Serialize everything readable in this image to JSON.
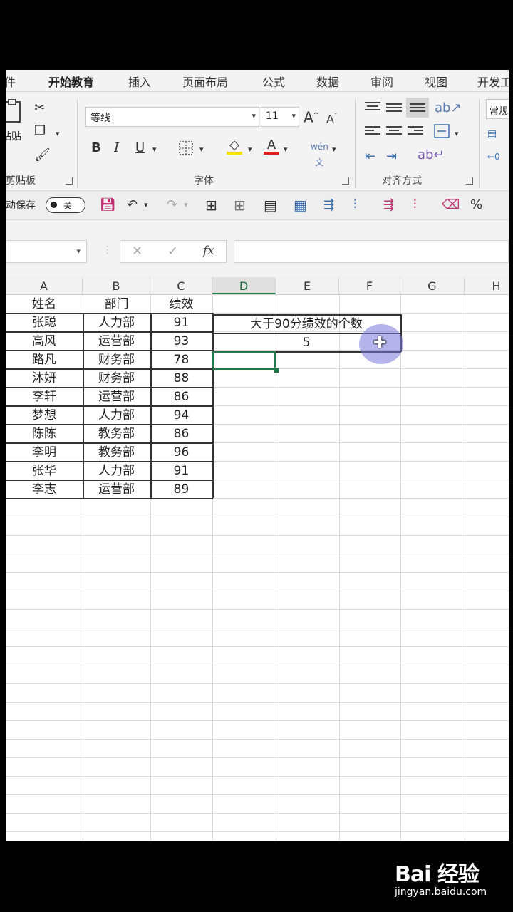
{
  "ribbon": {
    "tabs": [
      "文件",
      "开始教育",
      "插入",
      "页面布局",
      "公式",
      "数据",
      "审阅",
      "视图",
      "开发工具"
    ],
    "active_tab": "开始教育",
    "groups": {
      "clipboard": "剪贴板",
      "font": "字体",
      "alignment": "对齐方式"
    },
    "clipboard_paste_label": "粘贴",
    "font_name": "等线",
    "font_size": "11",
    "number_format": "常规"
  },
  "qat": {
    "autosave_label": "自动保存",
    "autosave_state": "关"
  },
  "formula_bar": {
    "name_box": "",
    "formula": ""
  },
  "sheet": {
    "columns": [
      "A",
      "B",
      "C",
      "D",
      "E",
      "F",
      "G",
      "H"
    ],
    "selected_column": "D",
    "table_header": [
      "姓名",
      "部门",
      "绩效"
    ],
    "rows": [
      [
        "张聪",
        "人力部",
        "91"
      ],
      [
        "高风",
        "运营部",
        "93"
      ],
      [
        "路凡",
        "财务部",
        "78"
      ],
      [
        "沐妍",
        "财务部",
        "88"
      ],
      [
        "李轩",
        "运营部",
        "86"
      ],
      [
        "梦想",
        "人力部",
        "94"
      ],
      [
        "陈陈",
        "教务部",
        "86"
      ],
      [
        "李明",
        "教务部",
        "96"
      ],
      [
        "张华",
        "人力部",
        "91"
      ],
      [
        "李志",
        "运营部",
        "89"
      ]
    ],
    "result_label": "大于90分绩效的个数",
    "result_value": "5"
  },
  "watermark": {
    "logo": "Bai 经验",
    "url": "jingyan.baidu.com"
  }
}
